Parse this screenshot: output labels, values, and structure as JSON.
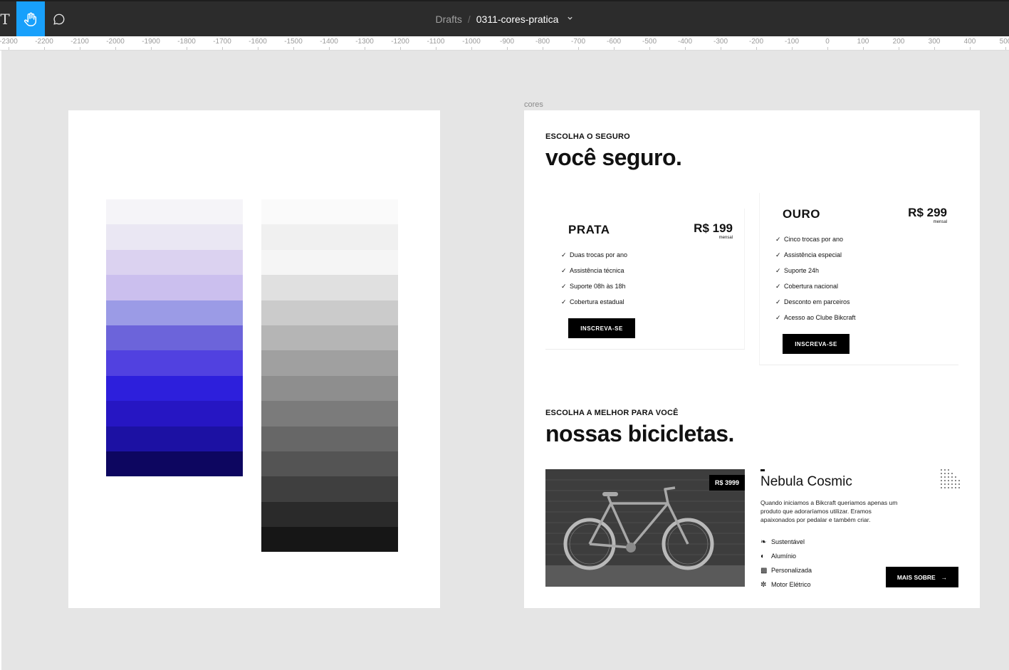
{
  "toolbar": {
    "text_tool_glyph": "T",
    "hand_tool": "hand-tool",
    "comment_tool": "comment-tool"
  },
  "breadcrumb": {
    "parent": "Drafts",
    "separator": "/",
    "file": "0311-cores-pratica",
    "chevron": "⌄"
  },
  "ruler": {
    "labels": [
      "-2300",
      "-2200",
      "-2100",
      "-2000",
      "-1900",
      "-1800",
      "-1700",
      "-1600",
      "-1500",
      "-1400",
      "-1300",
      "-1200",
      "-1100",
      "-1000",
      "-900",
      "-800",
      "-700",
      "-600",
      "-500",
      "-400",
      "-300",
      "-200",
      "-100",
      "0",
      "100",
      "200",
      "300",
      "400",
      "500"
    ]
  },
  "frames": {
    "right_label": "cores"
  },
  "palettes": {
    "purple": [
      "#f5f4f8",
      "#eae7f3",
      "#dbd2f0",
      "#cbbfee",
      "#9b9be6",
      "#6c64da",
      "#5141e0",
      "#2d1fdc",
      "#2616c3",
      "#1c11a3",
      "#0d0660"
    ],
    "gray": [
      "#fafafa",
      "#f0f0f0",
      "#f5f5f5",
      "#e0e0e0",
      "#cbcbcb",
      "#b5b5b5",
      "#a0a0a0",
      "#8e8e8e",
      "#7b7b7b",
      "#676767",
      "#545454",
      "#3f3f3f",
      "#2a2a2a",
      "#161616"
    ]
  },
  "insurance": {
    "eyebrow": "ESCOLHA O SEGURO",
    "headline": "você seguro.",
    "plans": [
      {
        "name": "PRATA",
        "price": "R$ 199",
        "period": "mensal",
        "features": [
          "Duas trocas por ano",
          "Assistência técnica",
          "Suporte 08h às 18h",
          "Cobertura estadual"
        ],
        "button": "INSCREVA-SE"
      },
      {
        "name": "OURO",
        "price": "R$ 299",
        "period": "mensal",
        "features": [
          "Cinco trocas por ano",
          "Assistência especial",
          "Suporte 24h",
          "Cobertura nacional",
          "Desconto em parceiros",
          "Acesso ao Clube Bikcraft"
        ],
        "button": "INSCREVA-SE"
      }
    ]
  },
  "bikes": {
    "eyebrow": "ESCOLHA A MELHOR PARA VOCÊ",
    "headline": "nossas bicicletas.",
    "item": {
      "price": "R$ 3999",
      "title": "Nebula Cosmic",
      "description": "Quando iniciamos a Bikcraft queriamos apenas um produto que adoraríamos utilizar. Eramos apaixonados por pedalar e também criar.",
      "features": [
        "Sustentável",
        "Alumínio",
        "Personalizada",
        "Motor Elétrico"
      ],
      "button": "MAIS SOBRE"
    }
  }
}
